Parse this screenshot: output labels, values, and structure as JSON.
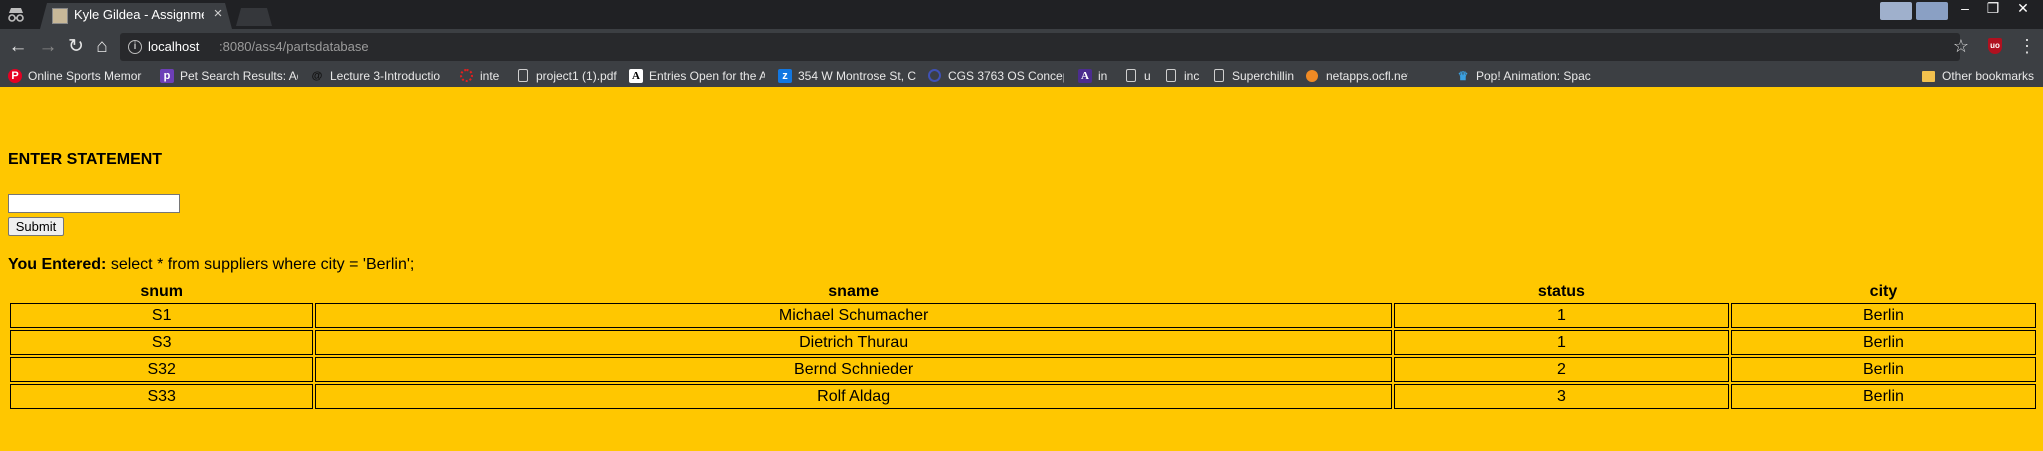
{
  "browser": {
    "tab": {
      "title": "Kyle Gildea - Assignment"
    },
    "address": {
      "host": "localhost",
      "path": ":8080/ass4/partsdatabase"
    },
    "window_controls": {
      "minimize": "–",
      "maximize": "❐",
      "close": "✕"
    },
    "bookmarks": [
      {
        "label": "Online Sports Memor",
        "icon": "pinterest-icon",
        "color": "#e60023"
      },
      {
        "label": "Pet Search Results: Ad",
        "icon": "pf-icon",
        "color": "#6d3fb7"
      },
      {
        "label": "Lecture 3-Introductio",
        "icon": "spiral-icon",
        "color": "#333333"
      },
      {
        "label": "inte",
        "icon": "ring-icon",
        "color": "#e02020"
      },
      {
        "label": "project1 (1).pdf",
        "icon": "page-icon",
        "color": "#cfcfcf"
      },
      {
        "label": "Entries Open for the A",
        "icon": "a-icon",
        "color": "#000000"
      },
      {
        "label": "354 W Montrose St, C",
        "icon": "zillow-icon",
        "color": "#1277e1"
      },
      {
        "label": "CGS 3763 OS Concep",
        "icon": "circle-icon",
        "color": "#3f51b5"
      },
      {
        "label": "in",
        "icon": "a-purple-icon",
        "color": "#4b2c8f"
      },
      {
        "label": "u",
        "icon": "page-icon",
        "color": "#cfcfcf"
      },
      {
        "label": "inc",
        "icon": "page-icon",
        "color": "#cfcfcf"
      },
      {
        "label": "Superchillin",
        "icon": "page-icon",
        "color": "#cfcfcf"
      },
      {
        "label": "netapps.ocfl.net/nsp/",
        "icon": "orange-icon",
        "color": "#f08a24"
      },
      {
        "label": "Pop! Animation: Spac",
        "icon": "crown-icon",
        "color": "#3aa0e0"
      }
    ],
    "other_bookmarks": "Other bookmarks"
  },
  "page": {
    "heading": "ENTER STATEMENT",
    "input": {
      "value": "",
      "placeholder": ""
    },
    "submit_label": "Submit",
    "entered_label": "You Entered:",
    "entered_value": " select * from suppliers where city = 'Berlin';",
    "table": {
      "columns": [
        "snum",
        "sname",
        "status",
        "city"
      ],
      "rows": [
        [
          "S1",
          "Michael Schumacher",
          "1",
          "Berlin"
        ],
        [
          "S3",
          "Dietrich Thurau",
          "1",
          "Berlin"
        ],
        [
          "S32",
          "Bernd Schnieder",
          "2",
          "Berlin"
        ],
        [
          "S33",
          "Rolf Aldag",
          "3",
          "Berlin"
        ]
      ]
    }
  },
  "colors": {
    "page_background": "#ffc700",
    "chrome_dark": "#202124",
    "chrome_toolbar": "#3c3f43"
  }
}
